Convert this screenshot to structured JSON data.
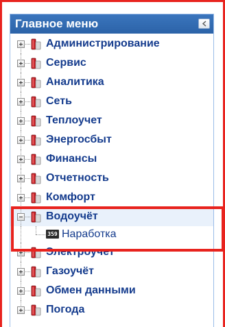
{
  "panel": {
    "title": "Главное меню",
    "collapse_icon": "chevron-left-icon"
  },
  "tree": {
    "items_before": [
      {
        "label": "Администрирование"
      },
      {
        "label": "Сервис"
      },
      {
        "label": "Аналитика"
      },
      {
        "label": "Сеть"
      },
      {
        "label": "Теплоучет"
      },
      {
        "label": "Энергосбыт"
      },
      {
        "label": "Финансы"
      },
      {
        "label": "Отчетность"
      },
      {
        "label": "Комфорт"
      }
    ],
    "expanded_item": {
      "label": "Водоучёт",
      "child": {
        "badge": "359",
        "label": "Наработка"
      }
    },
    "items_after": [
      {
        "label": "Электроучет"
      },
      {
        "label": "Газоучёт"
      },
      {
        "label": "Обмен данными"
      },
      {
        "label": "Погода"
      }
    ]
  },
  "colors": {
    "header_bg": "#2c63a8",
    "label": "#143b8d",
    "highlight": "#e8231e"
  }
}
